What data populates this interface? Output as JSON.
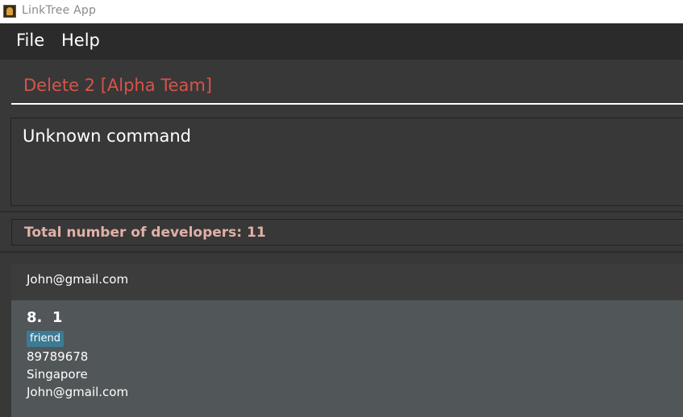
{
  "window": {
    "title": "LinkTree App"
  },
  "menu": {
    "file": "File",
    "help": "Help"
  },
  "command": {
    "value": "Delete 2 [Alpha Team]",
    "text_color": "#d6544a"
  },
  "result": {
    "message": "Unknown command"
  },
  "status": {
    "text": "Total number of developers: 11"
  },
  "list": {
    "partial_card": {
      "email": "John@gmail.com"
    },
    "cards": [
      {
        "index_name": "8.  1",
        "tags": [
          "friend"
        ],
        "phone": "89789678",
        "address": "Singapore",
        "email": "John@gmail.com"
      }
    ]
  },
  "colors": {
    "background": "#383838",
    "menubar": "#2b2b2b",
    "selected_card": "#515658",
    "tag": "#3d7a94",
    "status_text": "#e0b0a8"
  }
}
